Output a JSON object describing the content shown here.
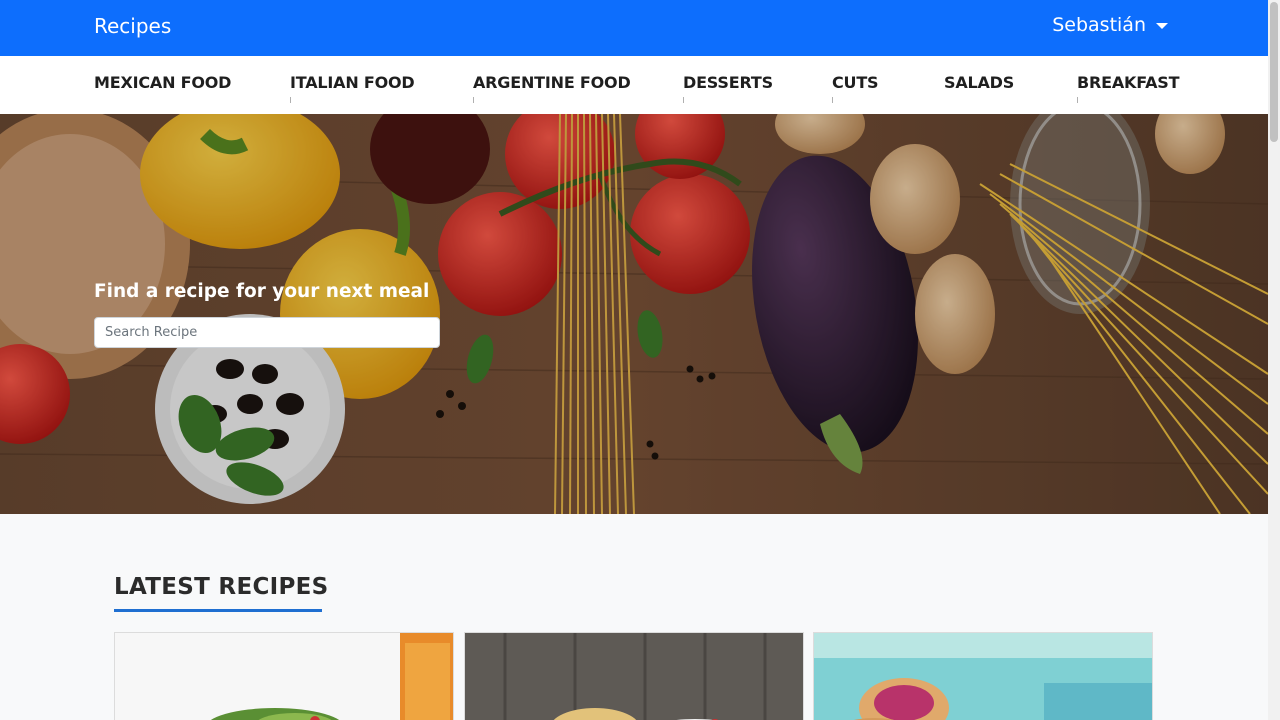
{
  "navbar": {
    "brand": "Recipes",
    "user_name": "Sebastián"
  },
  "categories": [
    {
      "label": "MEXICAN FOOD"
    },
    {
      "label": "ITALIAN FOOD"
    },
    {
      "label": "ARGENTINE FOOD"
    },
    {
      "label": "DESSERTS"
    },
    {
      "label": "CUTS"
    },
    {
      "label": "SALADS"
    },
    {
      "label": "BREAKFAST"
    }
  ],
  "hero": {
    "title": "Find a recipe for your next meal",
    "search_placeholder": "Search Recipe"
  },
  "latest": {
    "title": "LATEST RECIPES"
  },
  "colors": {
    "primary": "#0d6efd",
    "underline": "#1f6fd1"
  }
}
